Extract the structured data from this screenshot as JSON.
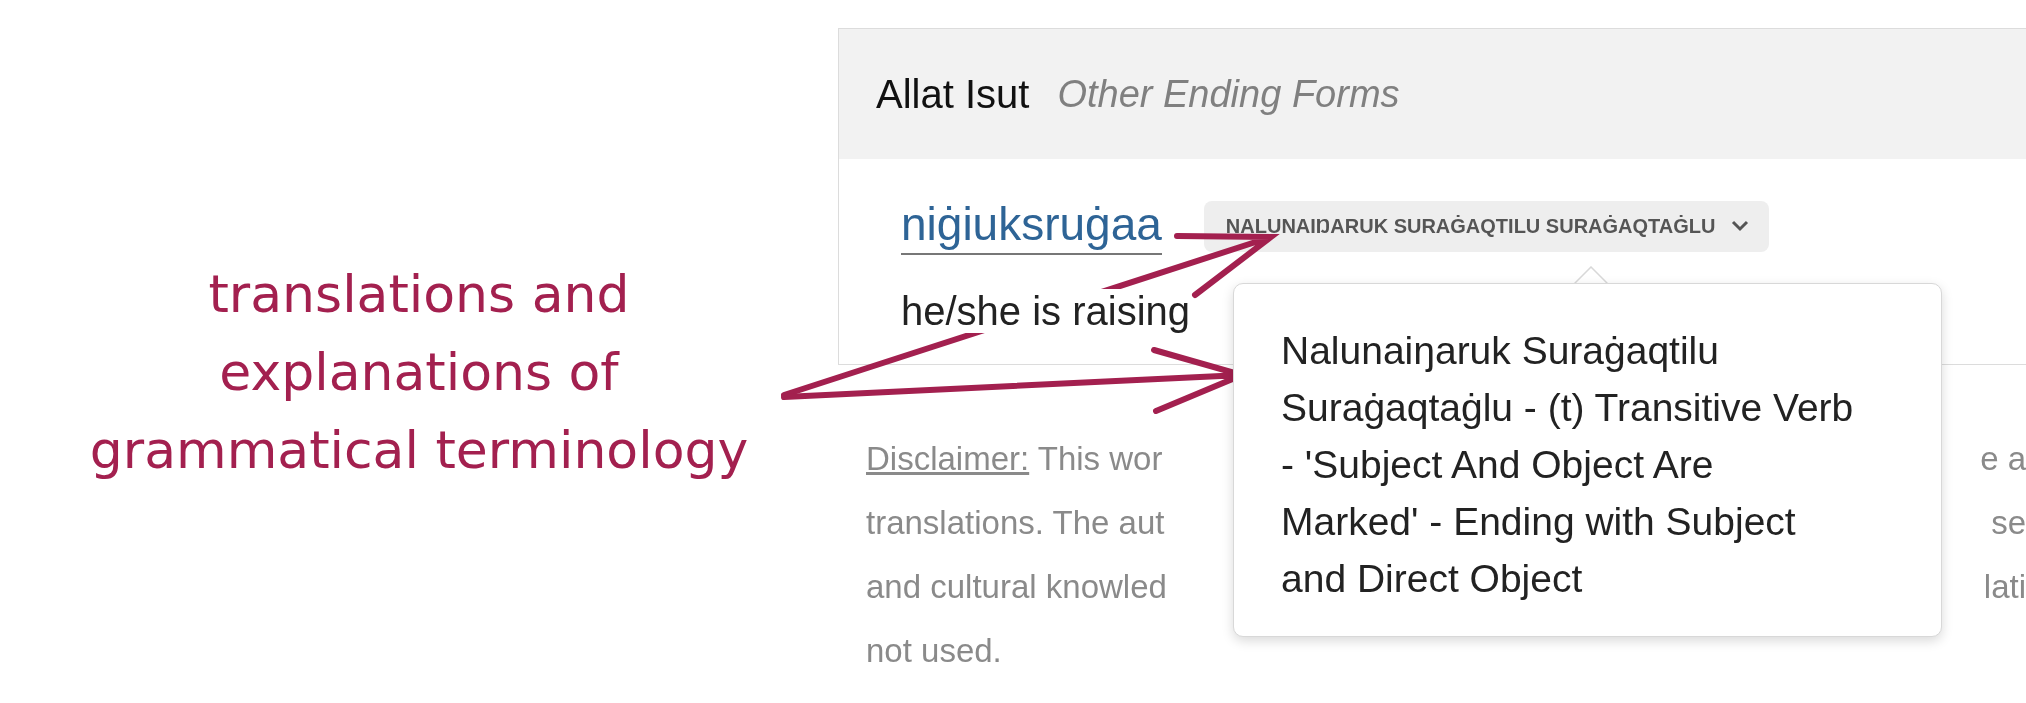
{
  "annotation": {
    "lines": [
      "translations and",
      "explanations of",
      "grammatical terminology"
    ]
  },
  "card": {
    "title": "Allat Isut",
    "subtitle": "Other Ending Forms",
    "word": "niġiuksruġaa",
    "tag": "NALUNAIŊARUK SURAĠAQTILU SURAĠAQTAĠLU",
    "translation": "he/she is raising"
  },
  "popover": {
    "text": "Nalunaiŋaruk Suraġaqtilu Suraġaqtaġlu - (t) Transitive Verb - 'Subject And Object Are Marked' - Ending with Subject and Direct Object"
  },
  "disclaimer": {
    "label": "Disclaimer:",
    "lines": [
      {
        "left": "This wor",
        "right": "e a"
      },
      {
        "left": "translations. The aut",
        "right": "se"
      },
      {
        "left": "and cultural knowled",
        "right": "lati"
      },
      {
        "left": "not used."
      }
    ]
  }
}
